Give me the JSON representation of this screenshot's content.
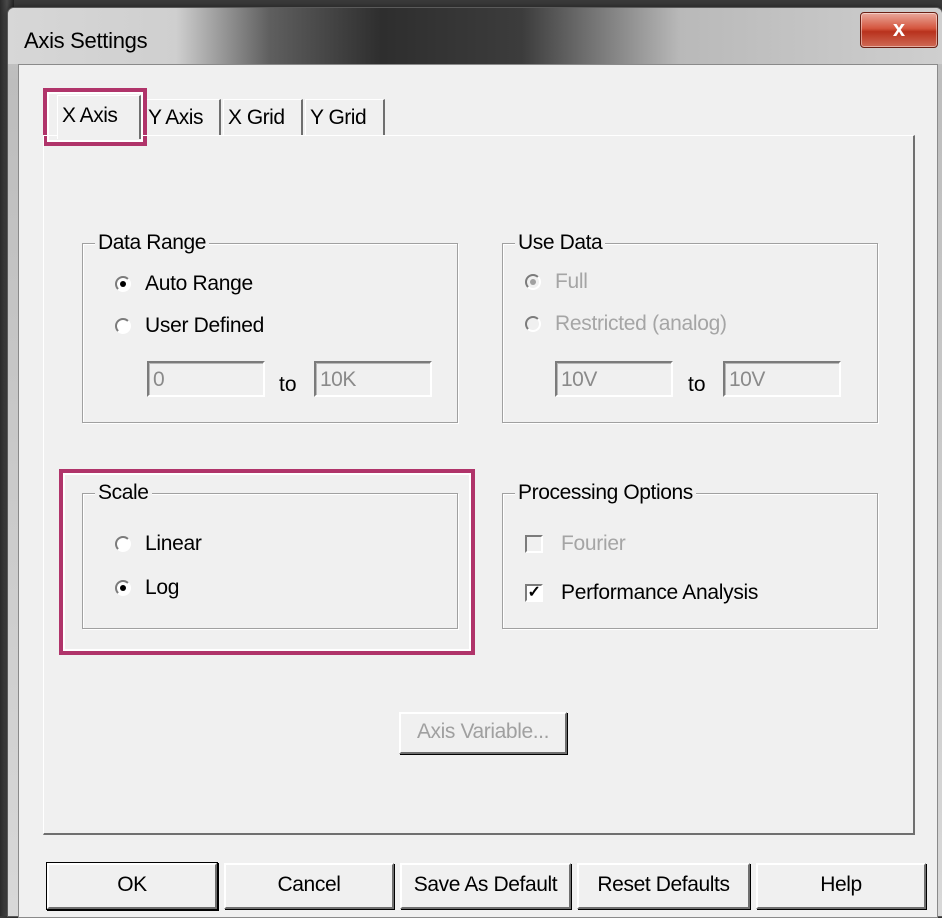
{
  "window": {
    "title": "Axis Settings",
    "close_label": "x"
  },
  "tabs": [
    {
      "label": "X Axis",
      "active": true
    },
    {
      "label": "Y Axis",
      "active": false
    },
    {
      "label": "X Grid",
      "active": false
    },
    {
      "label": "Y Grid",
      "active": false
    }
  ],
  "data_range": {
    "title": "Data Range",
    "auto_range": "Auto Range",
    "user_defined": "User Defined",
    "selected": "auto_range",
    "from_value": "0",
    "to_label": "to",
    "to_value": "10K"
  },
  "use_data": {
    "title": "Use Data",
    "full": "Full",
    "restricted": "Restricted (analog)",
    "selected": "full",
    "from_value": "10V",
    "to_label": "to",
    "to_value": "10V"
  },
  "scale": {
    "title": "Scale",
    "linear": "Linear",
    "log": "Log",
    "selected": "log"
  },
  "processing_options": {
    "title": "Processing Options",
    "fourier": "Fourier",
    "fourier_checked": false,
    "performance_analysis": "Performance Analysis",
    "performance_checked": true
  },
  "axis_variable_button": "Axis Variable...",
  "buttons": {
    "ok": "OK",
    "cancel": "Cancel",
    "save_default": "Save As Default",
    "reset_defaults": "Reset Defaults",
    "help": "Help"
  },
  "highlight_color": "#b0346a"
}
